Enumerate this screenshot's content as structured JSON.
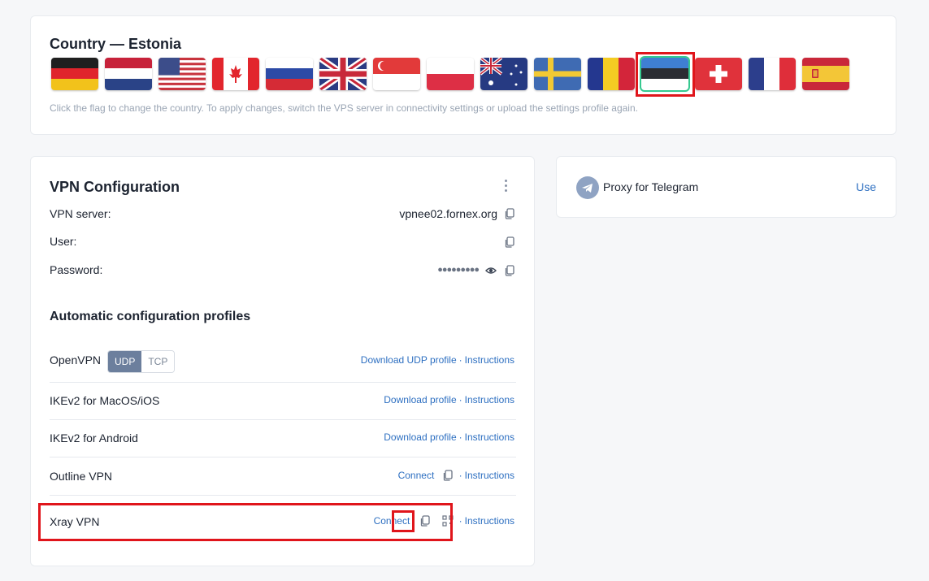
{
  "country": {
    "title": "Country — Estonia",
    "hint": "Click the flag to change the country. To apply changes, switch the VPS server in connectivity settings or upload the settings profile again.",
    "flags": [
      "germany",
      "netherlands",
      "usa",
      "canada",
      "russia",
      "uk",
      "singapore",
      "poland",
      "australia",
      "sweden",
      "romania",
      "estonia",
      "switzerland",
      "france",
      "spain"
    ],
    "selected": "estonia"
  },
  "vpn": {
    "title": "VPN Configuration",
    "server_label": "VPN server:",
    "server_value": "vpnee02.fornex.org",
    "user_label": "User:",
    "password_label": "Password:",
    "password_value": "●●●●●●●●●"
  },
  "profiles": {
    "title": "Automatic configuration profiles",
    "items": [
      {
        "name": "OpenVPN",
        "link": "Download UDP profile",
        "instructions": "Instructions"
      },
      {
        "name": "IKEv2 for MacOS/iOS",
        "link": "Download profile",
        "instructions": "Instructions"
      },
      {
        "name": "IKEv2 for Android",
        "link": "Download profile",
        "instructions": "Instructions"
      },
      {
        "name": "Outline VPN",
        "link": "Connect",
        "instructions": "Instructions"
      },
      {
        "name": "Xray VPN",
        "link": "Connect",
        "instructions": "Instructions"
      }
    ],
    "toggle": {
      "udp": "UDP",
      "tcp": "TCP"
    }
  },
  "telegram": {
    "label": "Proxy for Telegram",
    "use": "Use"
  },
  "colors": {
    "accent": "#2d6fc1",
    "highlight": "#e0151b",
    "selected_outline": "#36c990"
  }
}
